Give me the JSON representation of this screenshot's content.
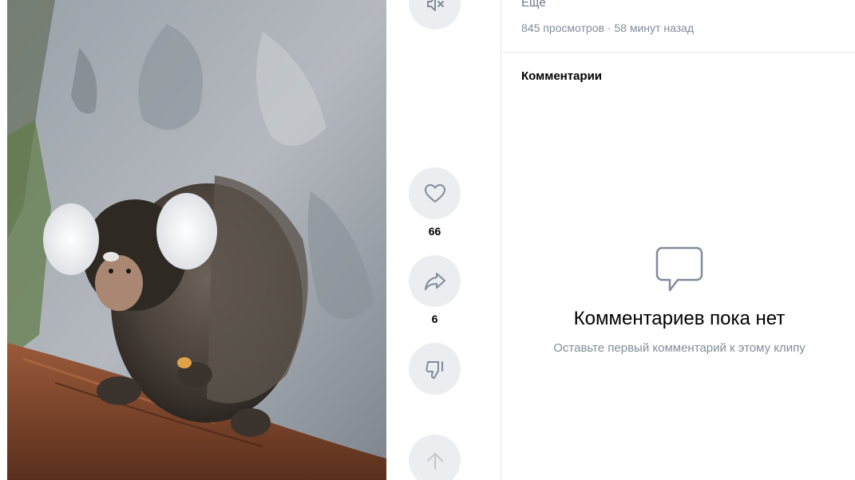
{
  "video": {
    "description_image": "marmoset-on-branch"
  },
  "actions": {
    "mute_icon": "speaker-muted-icon",
    "like_icon": "heart-icon",
    "like_count": "66",
    "share_icon": "share-arrow-icon",
    "share_count": "6",
    "dislike_icon": "thumb-down-icon",
    "scroll_up_icon": "arrow-up-icon"
  },
  "info": {
    "more_label": "Ещё",
    "views": "845 просмотров",
    "separator": "·",
    "time_ago": "58 минут назад"
  },
  "comments": {
    "heading": "Комментарии",
    "empty_icon": "speech-bubble-icon",
    "empty_title": "Комментариев пока нет",
    "empty_subtitle": "Оставьте первый комментарий к этому клипу"
  },
  "colors": {
    "button_bg": "#ebedf0",
    "icon_gray": "#818c99",
    "secondary_text": "#818c99",
    "divider": "#e7e8ec"
  }
}
